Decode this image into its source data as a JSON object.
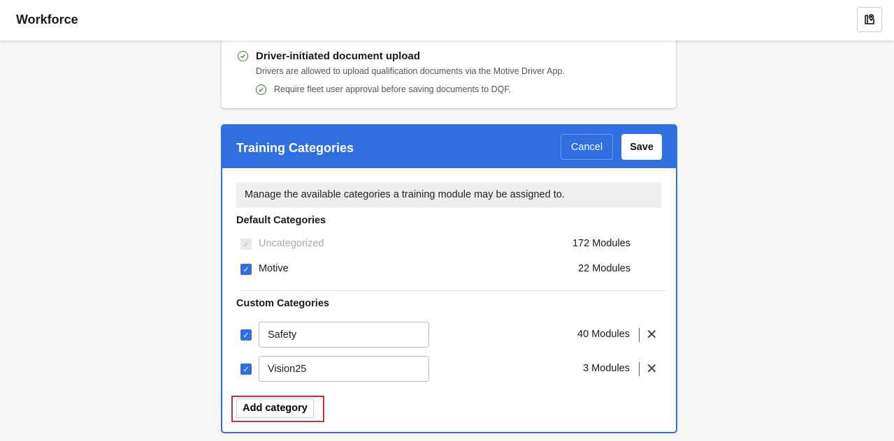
{
  "header": {
    "title": "Workforce",
    "icon": "map-book-icon"
  },
  "upload_card": {
    "title": "Driver-initiated document upload",
    "description": "Drivers are allowed to upload qualification documents via the Motive Driver App.",
    "sub_option": "Require fleet user approval before saving documents to DQF."
  },
  "panel": {
    "title": "Training Categories",
    "cancel": "Cancel",
    "save": "Save",
    "info": "Manage the available categories a training module may be assigned to.",
    "default_heading": "Default Categories",
    "defaults": [
      {
        "name": "Uncategorized",
        "count": "172 Modules",
        "checked": true,
        "disabled": true
      },
      {
        "name": "Motive",
        "count": "22 Modules",
        "checked": true
      }
    ],
    "custom_heading": "Custom Categories",
    "custom": [
      {
        "name": "Safety",
        "count": "40 Modules",
        "checked": true
      },
      {
        "name": "Vision25",
        "count": "3 Modules",
        "checked": true
      }
    ],
    "add": "Add category"
  },
  "colors": {
    "accent": "#2f6fdf",
    "success": "#2e7d32",
    "highlight": "#d32f2f"
  }
}
